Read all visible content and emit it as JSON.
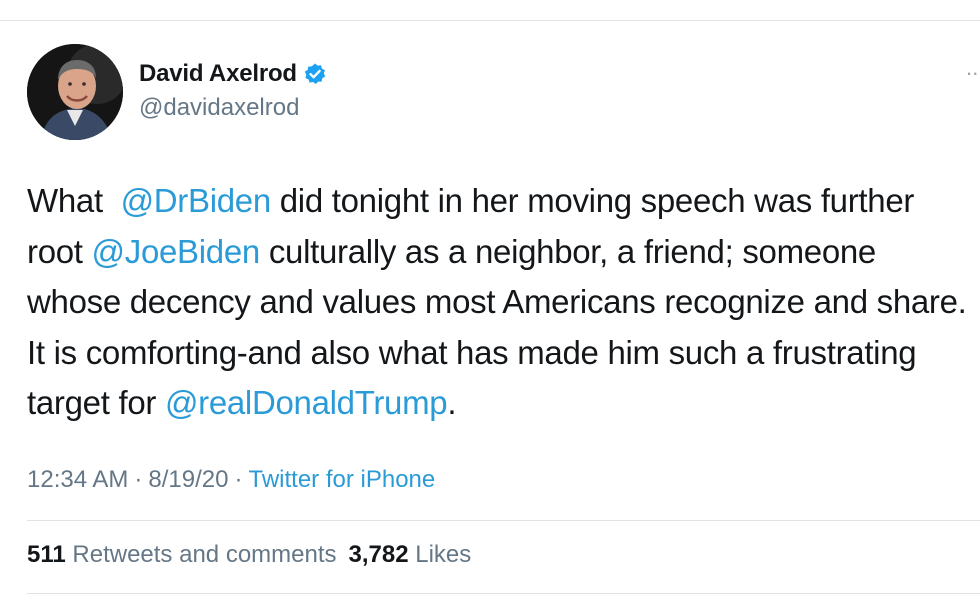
{
  "author": {
    "display_name": "David Axelrod",
    "handle": "@davidaxelrod",
    "verified": true,
    "avatar_icon": "profile-photo"
  },
  "more_icon": "ellipsis-icon",
  "tweet": {
    "segments": [
      {
        "type": "text",
        "text": "What  "
      },
      {
        "type": "mention",
        "text": "@DrBiden"
      },
      {
        "type": "text",
        "text": " did tonight in her moving speech was further root "
      },
      {
        "type": "mention",
        "text": "@JoeBiden"
      },
      {
        "type": "text",
        "text": " culturally as a neighbor, a friend; someone whose decency and values most Americans recognize and share.  It is comforting-and also what has made him such a frustrating target for "
      },
      {
        "type": "mention",
        "text": "@realDonaldTrump"
      },
      {
        "type": "text",
        "text": "."
      }
    ]
  },
  "meta": {
    "time": "12:34 AM",
    "date": "8/19/20",
    "separator": "·",
    "source": "Twitter for iPhone"
  },
  "stats": {
    "retweets_count": "511",
    "retweets_label": "Retweets and comments",
    "likes_count": "3,782",
    "likes_label": "Likes"
  },
  "colors": {
    "link": "#2b9bd7",
    "text": "#14171a",
    "secondary": "#657786",
    "verified_badge": "#1da1f2"
  }
}
